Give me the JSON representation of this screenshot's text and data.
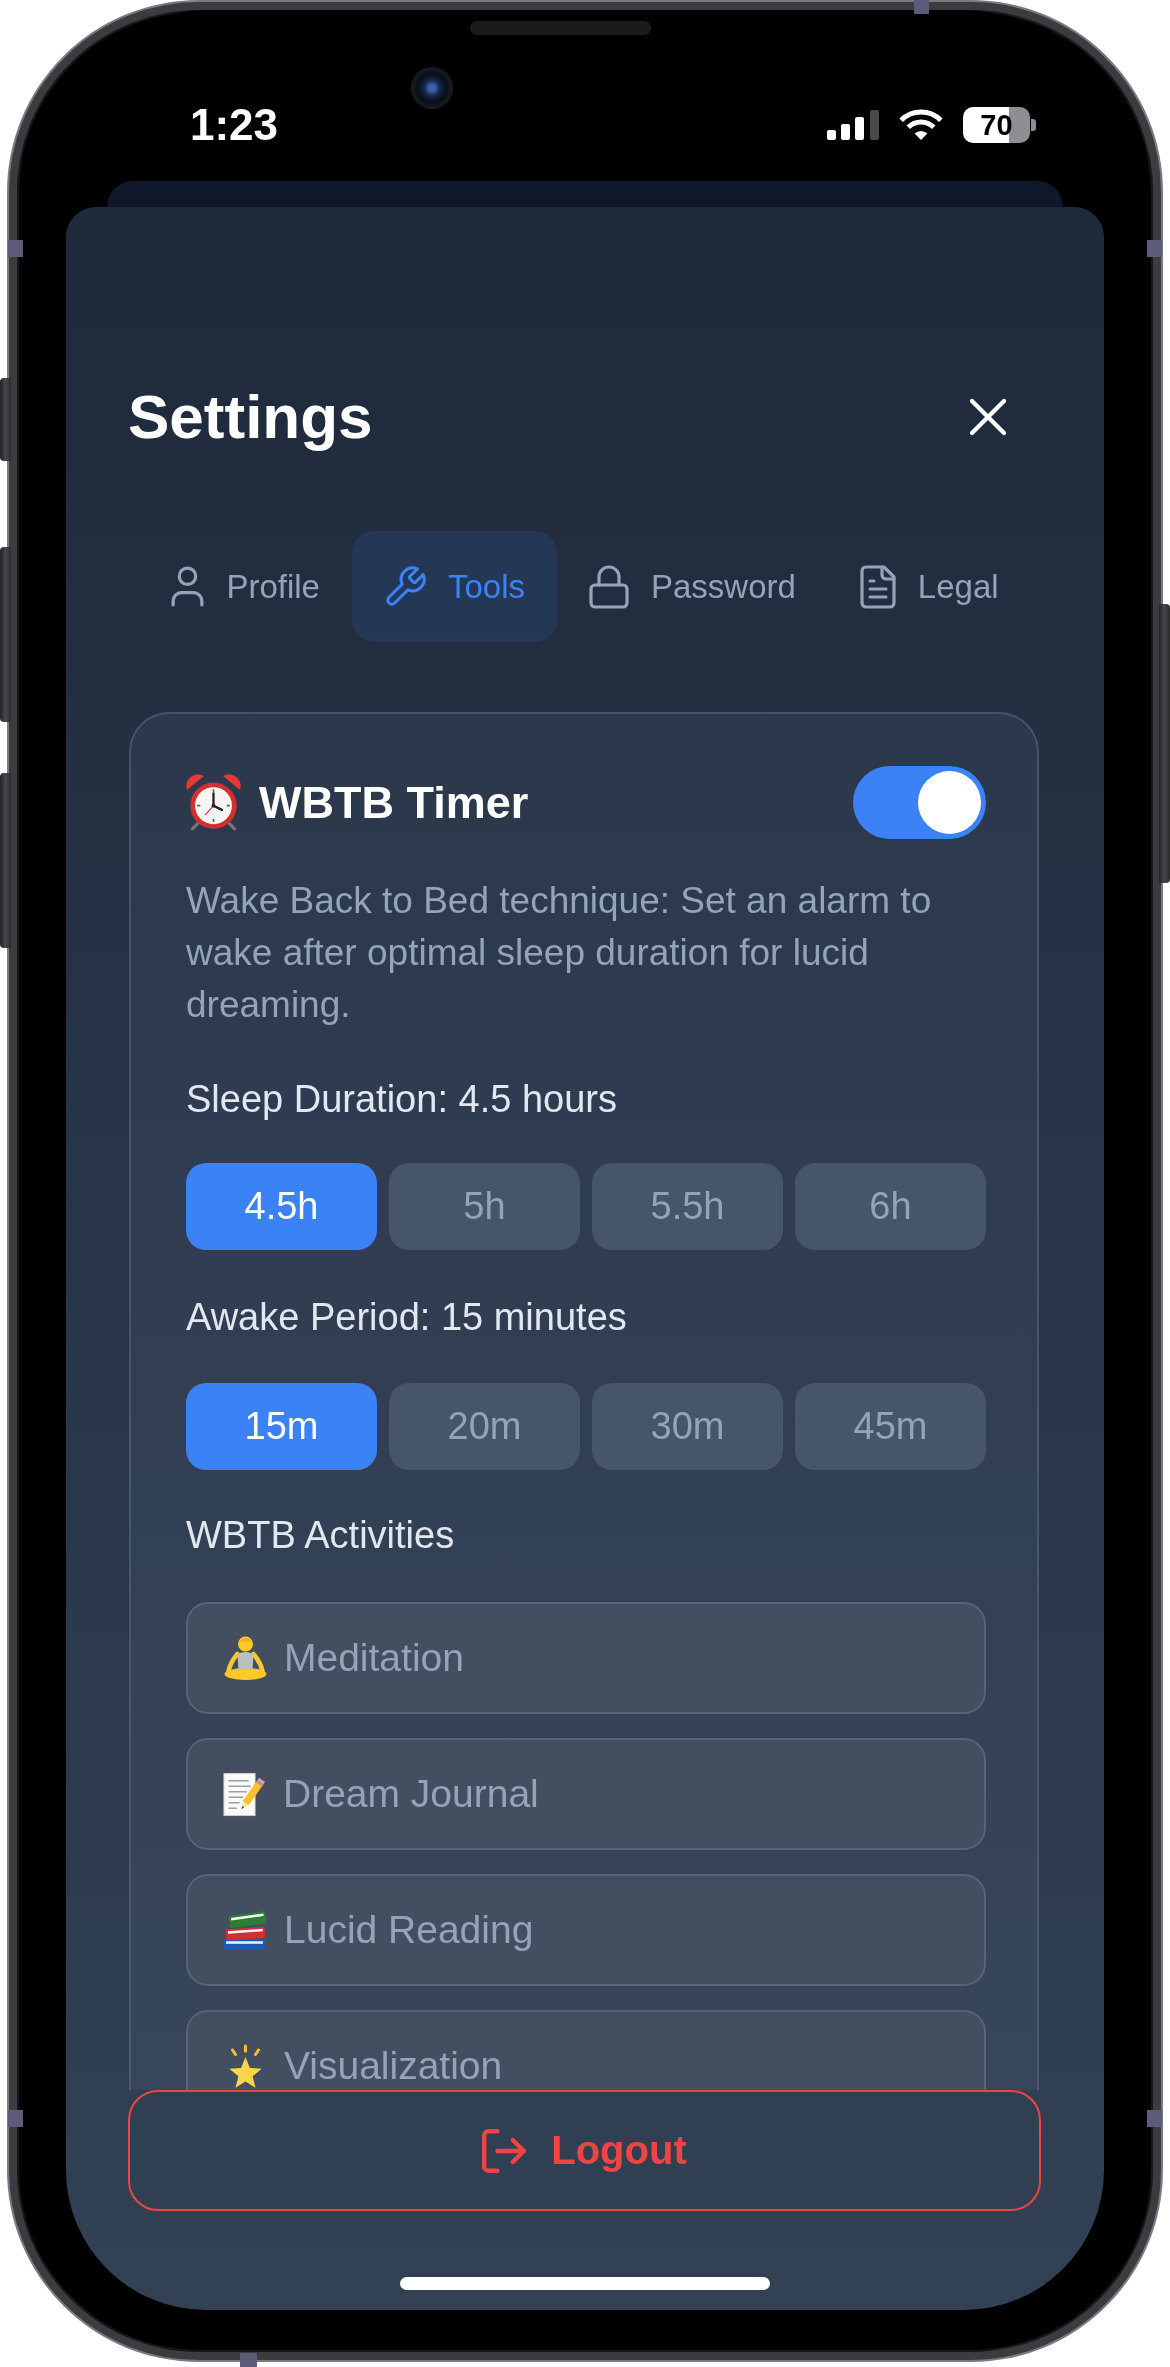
{
  "status_bar": {
    "time": "1:23",
    "battery": "70"
  },
  "title": "Settings",
  "tabs": [
    {
      "label": "Profile",
      "selected": false
    },
    {
      "label": "Tools",
      "selected": true
    },
    {
      "label": "Password",
      "selected": false
    },
    {
      "label": "Legal",
      "selected": false
    }
  ],
  "wbtb_timer": {
    "title": "WBTB Timer",
    "on": true,
    "description": "Wake Back to Bed technique: Set an alarm to wake after optimal sleep duration for lucid dreaming.",
    "sleep_duration": {
      "label": "Sleep Duration: 4.5 hours",
      "options": [
        {
          "label": "4.5h",
          "selected": true
        },
        {
          "label": "5h",
          "selected": false
        },
        {
          "label": "5.5h",
          "selected": false
        },
        {
          "label": "6h",
          "selected": false
        }
      ]
    },
    "awake_period": {
      "label": "Awake Period: 15 minutes",
      "options": [
        {
          "label": "15m",
          "selected": true
        },
        {
          "label": "20m",
          "selected": false
        },
        {
          "label": "30m",
          "selected": false
        },
        {
          "label": "45m",
          "selected": false
        }
      ]
    },
    "activities": {
      "label": "WBTB Activities",
      "items": [
        {
          "label": "Meditation",
          "selected": false
        },
        {
          "label": "Dream Journal",
          "selected": false
        },
        {
          "label": "Lucid Reading",
          "selected": false
        },
        {
          "label": "Visualization",
          "selected": false
        }
      ]
    }
  },
  "logout": {
    "label": "Logout"
  }
}
